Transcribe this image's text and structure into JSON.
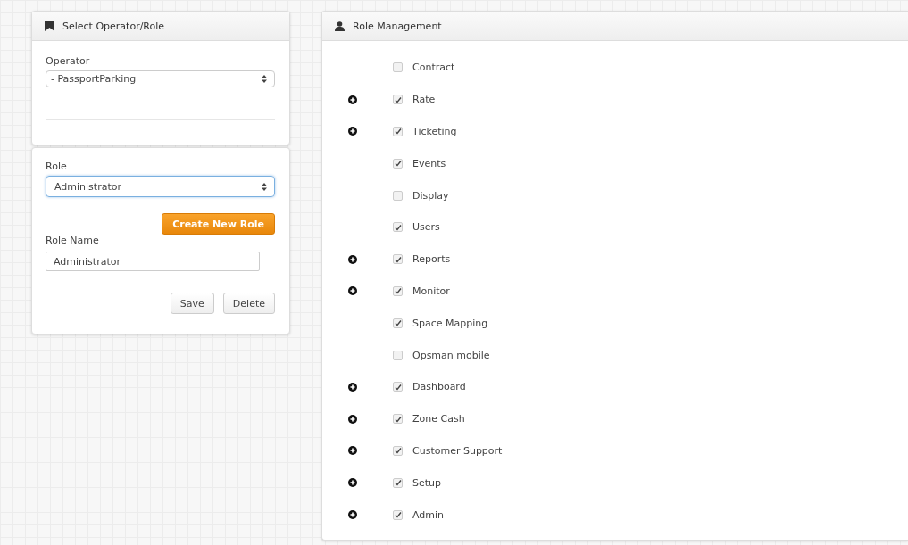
{
  "operator_panel": {
    "title": "Select Operator/Role",
    "operator_label": "Operator",
    "operator_value": "- PassportParking"
  },
  "role_panel": {
    "role_label": "Role",
    "role_value": "Administrator",
    "create_button": "Create New Role",
    "name_label": "Role Name",
    "name_value": "Administrator",
    "buttons": [
      "Save",
      "Delete"
    ]
  },
  "role_management": {
    "title": "Role Management",
    "permissions": [
      {
        "label": "Contract",
        "checked": false,
        "expandable": false
      },
      {
        "label": "Rate",
        "checked": true,
        "expandable": true
      },
      {
        "label": "Ticketing",
        "checked": true,
        "expandable": true
      },
      {
        "label": "Events",
        "checked": true,
        "expandable": false
      },
      {
        "label": "Display",
        "checked": false,
        "expandable": false
      },
      {
        "label": "Users",
        "checked": true,
        "expandable": false
      },
      {
        "label": "Reports",
        "checked": true,
        "expandable": true
      },
      {
        "label": "Monitor",
        "checked": true,
        "expandable": true
      },
      {
        "label": "Space Mapping",
        "checked": true,
        "expandable": false
      },
      {
        "label": "Opsman mobile",
        "checked": false,
        "expandable": false
      },
      {
        "label": "Dashboard",
        "checked": true,
        "expandable": true
      },
      {
        "label": "Zone Cash",
        "checked": true,
        "expandable": true
      },
      {
        "label": "Customer Support",
        "checked": true,
        "expandable": true
      },
      {
        "label": "Setup",
        "checked": true,
        "expandable": true
      },
      {
        "label": "Admin",
        "checked": true,
        "expandable": true
      }
    ]
  }
}
